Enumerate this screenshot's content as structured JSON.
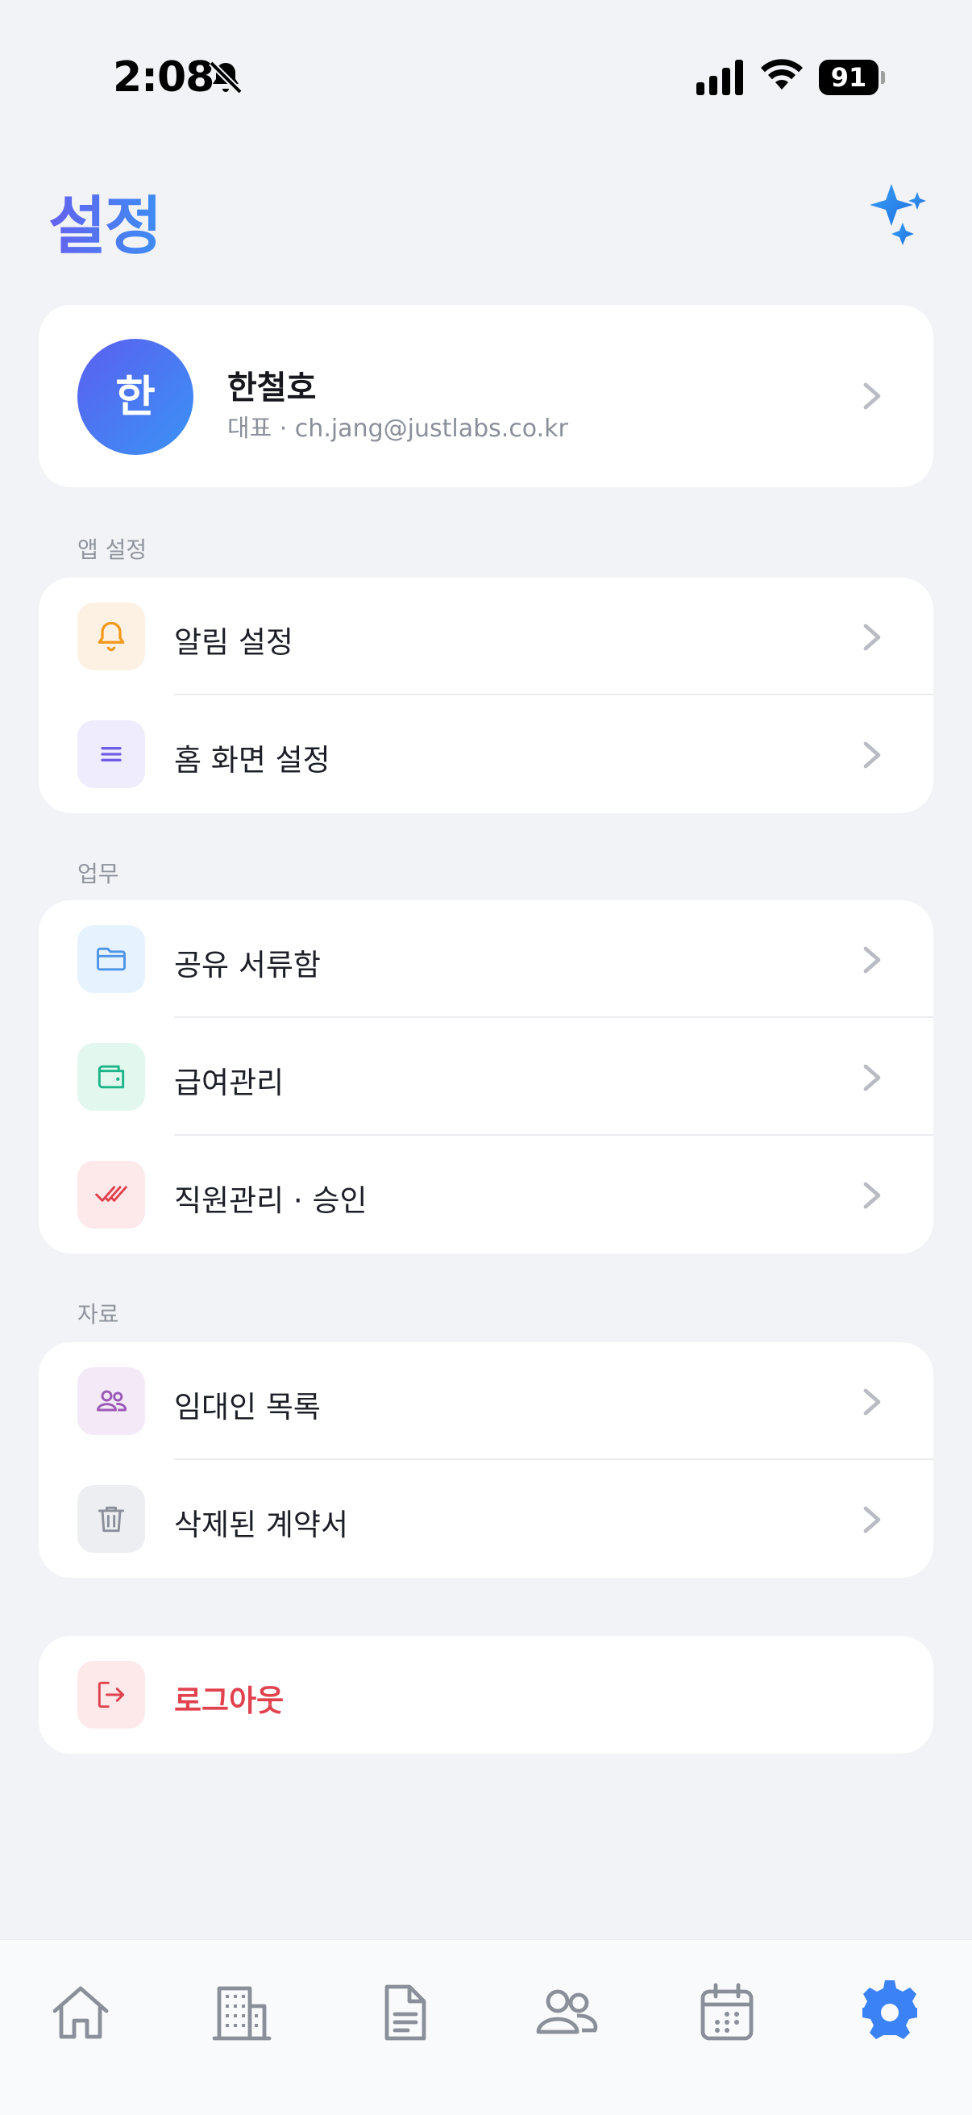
{
  "status_bar": {
    "time": "2:08",
    "battery": "91",
    "icons": [
      "bell-slash-icon",
      "cellular-signal-icon",
      "wifi-icon",
      "battery-icon"
    ]
  },
  "header": {
    "title": "설정",
    "action_icon": "sparkles-icon"
  },
  "profile": {
    "avatar_initial": "한",
    "name": "한철호",
    "subtitle": "대표 · ch.jang@justlabs.co.kr"
  },
  "sections": {
    "app_settings": {
      "label": "앱 설정",
      "items": [
        {
          "label": "알림 설정",
          "icon": "bell-icon"
        },
        {
          "label": "홈 화면 설정",
          "icon": "menu-lines-icon"
        }
      ]
    },
    "work": {
      "label": "업무",
      "items": [
        {
          "label": "공유 서류함",
          "icon": "folder-icon"
        },
        {
          "label": "급여관리",
          "icon": "wallet-icon"
        },
        {
          "label": "직원관리 · 승인",
          "icon": "double-check-icon"
        }
      ]
    },
    "resources": {
      "label": "자료",
      "items": [
        {
          "label": "임대인 목록",
          "icon": "people-icon"
        },
        {
          "label": "삭제된 계약서",
          "icon": "trash-icon"
        }
      ]
    }
  },
  "logout": {
    "label": "로그아웃",
    "icon": "logout-icon"
  },
  "bottom_nav": {
    "items": [
      {
        "name": "home",
        "icon": "home-icon"
      },
      {
        "name": "buildings",
        "icon": "building-icon"
      },
      {
        "name": "documents",
        "icon": "document-icon"
      },
      {
        "name": "people",
        "icon": "people-icon"
      },
      {
        "name": "calendar",
        "icon": "calendar-icon"
      },
      {
        "name": "settings",
        "icon": "gear-icon",
        "active": true
      }
    ]
  },
  "colors": {
    "accent": "#3b82f6",
    "title_gradient_start": "#6461f0",
    "title_gradient_end": "#3d8ef5",
    "logout": "#e0424e",
    "background": "#f2f3f6"
  }
}
